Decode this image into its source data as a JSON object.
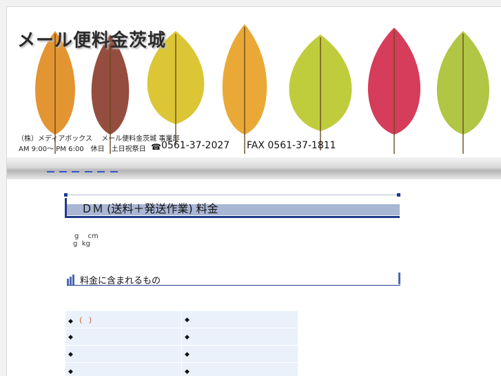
{
  "banner": {
    "site_title": "メール便料金茨城",
    "company_line": "（株）メディアボックス　 メール便料金茨城 事業部",
    "hours_line": "AM 9:00～ PM 6:00　休日　土日祝祭日",
    "tel": "0561-37-2027",
    "fax": "FAX 0561-37-1811",
    "phone_icon": "phone-icon",
    "leaf_colors": [
      "#e08a1c",
      "#8a3a2a",
      "#d8c020",
      "#e8a020",
      "#b8c828",
      "#d02848",
      "#a8c030"
    ]
  },
  "navbar": {
    "links": [
      "",
      "",
      "",
      "",
      "",
      ""
    ]
  },
  "main": {
    "heading": "ＤＭ (送料＋発送作業) 料金",
    "weight_line_1": "g　 cm",
    "weight_line_2": "g  kg",
    "subheading": "料金に含まれるもの",
    "table": {
      "rows": [
        [
          "（　）",
          ""
        ],
        [
          "",
          ""
        ],
        [
          "",
          ""
        ],
        [
          "",
          ""
        ]
      ],
      "bullet": "◆"
    }
  }
}
